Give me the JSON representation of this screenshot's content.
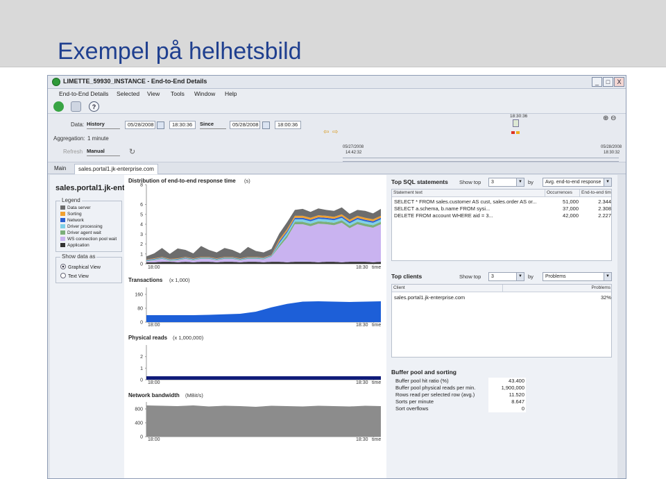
{
  "slide": {
    "title": "Exempel på helhetsbild"
  },
  "window": {
    "title": "LIMETTE_59930_INSTANCE - End-to-End Details",
    "btn_min": "_",
    "btn_max": "□",
    "btn_close": "X"
  },
  "menu": [
    "End-to-End Details",
    "Selected",
    "View",
    "Tools",
    "Window",
    "Help"
  ],
  "controls": {
    "data_label": "Data:",
    "data_value": "History",
    "from_date": "05/28/2008",
    "from_time": "18:30:36",
    "since_value": "Since",
    "to_date": "05/28/2008",
    "to_time": "18:00:36",
    "aggregation_label": "Aggregation:",
    "aggregation_value": "1 minute",
    "refresh_label": "Refresh",
    "refresh_value": "Manual",
    "slider_time": "18:30:36",
    "range_start_date": "05/27/2008",
    "range_start_time": "14:42:32",
    "range_end_date": "05/28/2008",
    "range_end_time": "18:30:32"
  },
  "tabs": [
    "Main",
    "sales.portal1.jk-enterprise.com"
  ],
  "host": "sales.portal1.jk-enterprise.com",
  "legend": {
    "title": "Legend",
    "items": [
      {
        "label": "Data server",
        "color": "#6d6d6d"
      },
      {
        "label": "Sorting",
        "color": "#f0a030"
      },
      {
        "label": "Network",
        "color": "#2a5fd0"
      },
      {
        "label": "Driver processing",
        "color": "#7fd0e8"
      },
      {
        "label": "Driver agent wait",
        "color": "#7cae7a"
      },
      {
        "label": "WS connection pool wait",
        "color": "#c9b3f0"
      },
      {
        "label": "Application",
        "color": "#333333"
      }
    ]
  },
  "show_data": {
    "title": "Show data as",
    "graphical": "Graphical View",
    "text": "Text View"
  },
  "charts": {
    "response": {
      "title": "Distribution of end-to-end response time",
      "unit": "(s)",
      "x_start": "18:00",
      "x_end": "18:30",
      "x_label": "time"
    },
    "transactions": {
      "title": "Transactions",
      "unit": "(x 1,000)",
      "x_start": "18:00",
      "x_end": "18:30",
      "x_label": "time"
    },
    "reads": {
      "title": "Physical reads",
      "unit": "(x 1,000,000)",
      "x_start": "18:00",
      "x_end": "18:30",
      "x_label": "time"
    },
    "network": {
      "title": "Network bandwidth",
      "unit": "(MBit/s)",
      "x_start": "18:00",
      "x_end": "18:30",
      "x_label": "time"
    }
  },
  "chart_data": [
    {
      "type": "area",
      "title": "Distribution of end-to-end response time",
      "ylabel": "(s)",
      "ylim": [
        0,
        8
      ],
      "yticks": [
        0,
        1,
        2,
        3,
        4,
        5,
        6,
        8
      ],
      "x": [
        0,
        1,
        2,
        3,
        4,
        5,
        6,
        7,
        8,
        9,
        10,
        11,
        12,
        13,
        14,
        15,
        16,
        17,
        18,
        19,
        20,
        21,
        22,
        23,
        24,
        25,
        26,
        27,
        28,
        29,
        30
      ],
      "series": [
        {
          "name": "Application",
          "color": "#333333",
          "values": [
            0.15,
            0.15,
            0.2,
            0.2,
            0.15,
            0.2,
            0.15,
            0.2,
            0.2,
            0.15,
            0.2,
            0.2,
            0.15,
            0.2,
            0.2,
            0.15,
            0.2,
            0.2,
            0.15,
            0.2,
            0.2,
            0.2,
            0.15,
            0.2,
            0.2,
            0.15,
            0.2,
            0.2,
            0.2,
            0.15,
            0.2
          ]
        },
        {
          "name": "WS connection pool wait",
          "color": "#c9b3f0",
          "values": [
            0.1,
            0.2,
            0.3,
            0.1,
            0.2,
            0.3,
            0.2,
            0.3,
            0.3,
            0.2,
            0.3,
            0.3,
            0.2,
            0.3,
            0.3,
            0.3,
            0.5,
            1.5,
            2.5,
            3.8,
            3.8,
            3.6,
            3.9,
            3.8,
            3.7,
            4.0,
            3.4,
            3.8,
            3.6,
            3.5,
            3.8
          ]
        },
        {
          "name": "Driver agent wait",
          "color": "#7cae7a",
          "values": [
            0.05,
            0.05,
            0.05,
            0.05,
            0.05,
            0.05,
            0.05,
            0.05,
            0.05,
            0.05,
            0.05,
            0.05,
            0.05,
            0.05,
            0.05,
            0.05,
            0.05,
            0.2,
            0.25,
            0.25,
            0.25,
            0.25,
            0.25,
            0.25,
            0.25,
            0.25,
            0.25,
            0.25,
            0.25,
            0.25,
            0.25
          ]
        },
        {
          "name": "Driver processing",
          "color": "#7fd0e8",
          "values": [
            0.05,
            0.05,
            0.05,
            0.05,
            0.05,
            0.05,
            0.05,
            0.05,
            0.05,
            0.05,
            0.05,
            0.05,
            0.05,
            0.05,
            0.05,
            0.05,
            0.05,
            0.2,
            0.25,
            0.25,
            0.25,
            0.25,
            0.25,
            0.25,
            0.25,
            0.25,
            0.25,
            0.25,
            0.25,
            0.25,
            0.25
          ]
        },
        {
          "name": "Network",
          "color": "#2a5fd0",
          "values": [
            0.05,
            0.05,
            0.05,
            0.05,
            0.05,
            0.05,
            0.05,
            0.05,
            0.05,
            0.05,
            0.05,
            0.05,
            0.05,
            0.05,
            0.05,
            0.05,
            0.05,
            0.15,
            0.15,
            0.15,
            0.15,
            0.15,
            0.15,
            0.15,
            0.15,
            0.15,
            0.15,
            0.15,
            0.15,
            0.15,
            0.15
          ]
        },
        {
          "name": "Sorting",
          "color": "#f0a030",
          "values": [
            0.05,
            0.05,
            0.05,
            0.05,
            0.05,
            0.05,
            0.05,
            0.05,
            0.05,
            0.05,
            0.05,
            0.05,
            0.05,
            0.05,
            0.05,
            0.05,
            0.05,
            0.2,
            0.2,
            0.2,
            0.2,
            0.2,
            0.2,
            0.2,
            0.2,
            0.2,
            0.2,
            0.2,
            0.2,
            0.2,
            0.2
          ]
        },
        {
          "name": "Data server",
          "color": "#6d6d6d",
          "values": [
            0.3,
            0.5,
            0.9,
            0.5,
            1.0,
            0.7,
            0.5,
            1.1,
            0.7,
            0.6,
            0.9,
            0.7,
            0.5,
            1.0,
            0.6,
            0.5,
            0.6,
            0.6,
            0.7,
            0.6,
            0.7,
            0.6,
            0.7,
            0.6,
            0.6,
            0.7,
            0.6,
            0.6,
            0.7,
            0.6,
            0.7
          ]
        }
      ]
    },
    {
      "type": "area",
      "title": "Transactions",
      "ylabel": "(x 1,000)",
      "ylim": [
        0,
        200
      ],
      "yticks": [
        0,
        80,
        160
      ],
      "x": [
        0,
        2,
        4,
        6,
        8,
        10,
        12,
        14,
        16,
        18,
        20,
        22,
        24,
        26,
        28,
        30
      ],
      "series": [
        {
          "name": "Transactions",
          "color": "#1d5fd8",
          "values": [
            40,
            40,
            40,
            40,
            42,
            45,
            48,
            60,
            85,
            105,
            118,
            120,
            118,
            116,
            118,
            120
          ]
        }
      ]
    },
    {
      "type": "area",
      "title": "Physical reads",
      "ylabel": "(x 1,000,000)",
      "ylim": [
        0,
        3
      ],
      "yticks": [
        0,
        1,
        2
      ],
      "x": [
        0,
        30
      ],
      "series": [
        {
          "name": "Physical reads",
          "color": "#101c7a",
          "values": [
            0.3,
            0.3
          ]
        }
      ]
    },
    {
      "type": "area",
      "title": "Network bandwidth",
      "ylabel": "(MBit/s)",
      "ylim": [
        0,
        1000
      ],
      "yticks": [
        0,
        400,
        800
      ],
      "x": [
        0,
        2,
        4,
        6,
        8,
        10,
        12,
        14,
        16,
        18,
        20,
        22,
        24,
        26,
        28,
        30
      ],
      "series": [
        {
          "name": "Network bandwidth",
          "color": "#8c8c8c",
          "values": [
            900,
            890,
            880,
            900,
            870,
            890,
            880,
            860,
            890,
            880,
            870,
            890,
            880,
            870,
            890,
            880
          ]
        }
      ]
    }
  ],
  "sql": {
    "title": "Top SQL statements",
    "show_top_label": "Show top",
    "show_top_value": "3",
    "by_label": "by",
    "by_value": "Avg. end-to-end response",
    "headers": [
      "Statement text",
      "Occurrences",
      "End-to-end time"
    ],
    "rows": [
      [
        "SELECT * FROM sales.customer AS cust, sales.order AS or...",
        "51,000",
        "2.344"
      ],
      [
        "SELECT a.schema, b.name FROM sysi...",
        "37,000",
        "2.308"
      ],
      [
        "DELETE FROM account WHERE aid = 3...",
        "42,000",
        "2.227"
      ]
    ]
  },
  "clients": {
    "title": "Top clients",
    "show_top_label": "Show top",
    "show_top_value": "3",
    "by_label": "by",
    "by_value": "Problems",
    "headers": [
      "Client",
      "Problems"
    ],
    "rows": [
      [
        "sales.portal1.jk-enterprise.com",
        "32%"
      ]
    ]
  },
  "buffer": {
    "title": "Buffer pool and sorting",
    "rows": [
      [
        "Buffer pool hit ratio (%)",
        "43.400"
      ],
      [
        "Buffer pool physical reads per min.",
        "1,900,000"
      ],
      [
        "Rows read per selected row (avg.)",
        "11.520"
      ],
      [
        "Sorts per minute",
        "8.647"
      ],
      [
        "Sort overflows",
        "0"
      ]
    ]
  }
}
